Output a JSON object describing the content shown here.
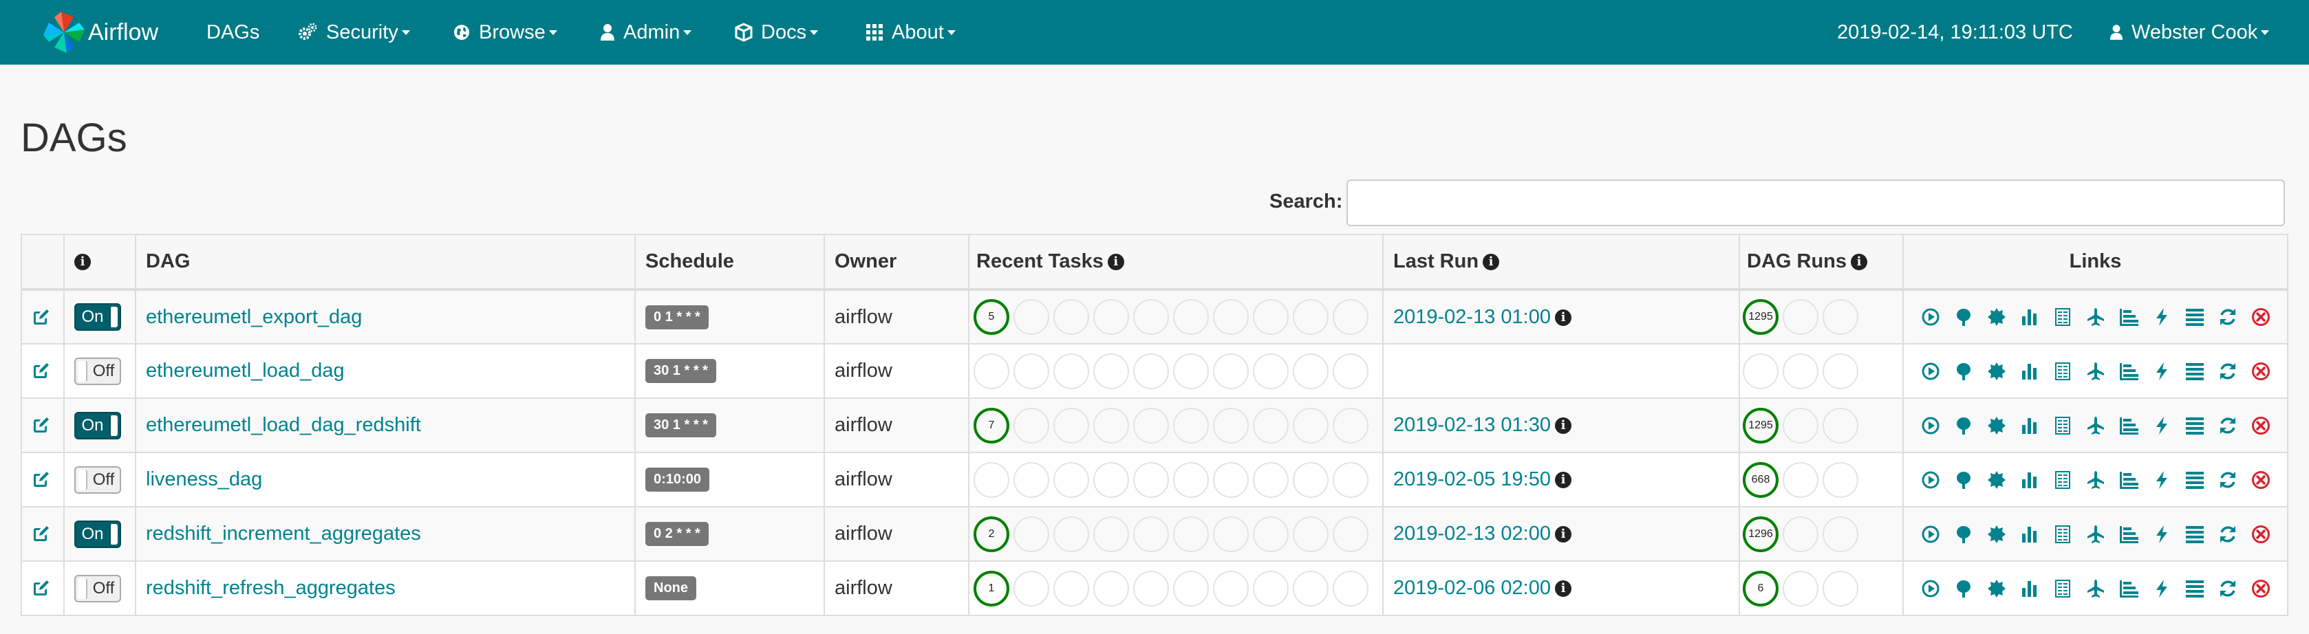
{
  "navbar": {
    "brand": "Airflow",
    "items": [
      {
        "label": "DAGs",
        "icon": "none",
        "dropdown": false
      },
      {
        "label": "Security",
        "icon": "cogs-icon",
        "dropdown": true
      },
      {
        "label": "Browse",
        "icon": "globe-icon",
        "dropdown": true
      },
      {
        "label": "Admin",
        "icon": "user-icon",
        "dropdown": true
      },
      {
        "label": "Docs",
        "icon": "cube-icon",
        "dropdown": true
      },
      {
        "label": "About",
        "icon": "th-icon",
        "dropdown": true
      }
    ],
    "clock": "2019-02-14, 19:11:03 UTC",
    "user": "Webster Cook"
  },
  "page": {
    "title": "DAGs",
    "search_label": "Search:",
    "search_value": ""
  },
  "table": {
    "headers": {
      "info": "i",
      "dag": "DAG",
      "schedule": "Schedule",
      "owner": "Owner",
      "recent_tasks": "Recent Tasks",
      "last_run": "Last Run",
      "dag_runs": "DAG Runs",
      "links": "Links"
    },
    "rows": [
      {
        "toggle": "On",
        "dag": "ethereumetl_export_dag",
        "schedule": "0 1 * * *",
        "owner": "airflow",
        "recent_tasks": [
          "5",
          "",
          "",
          "",
          "",
          "",
          "",
          "",
          "",
          ""
        ],
        "last_run": "2019-02-13 01:00",
        "dag_runs": [
          "1295",
          "",
          ""
        ]
      },
      {
        "toggle": "Off",
        "dag": "ethereumetl_load_dag",
        "schedule": "30 1 * * *",
        "owner": "airflow",
        "recent_tasks": [
          "",
          "",
          "",
          "",
          "",
          "",
          "",
          "",
          "",
          ""
        ],
        "last_run": "",
        "dag_runs": [
          "",
          "",
          ""
        ]
      },
      {
        "toggle": "On",
        "dag": "ethereumetl_load_dag_redshift",
        "schedule": "30 1 * * *",
        "owner": "airflow",
        "recent_tasks": [
          "7",
          "",
          "",
          "",
          "",
          "",
          "",
          "",
          "",
          ""
        ],
        "last_run": "2019-02-13 01:30",
        "dag_runs": [
          "1295",
          "",
          ""
        ]
      },
      {
        "toggle": "Off",
        "dag": "liveness_dag",
        "schedule": "0:10:00",
        "owner": "airflow",
        "recent_tasks": [
          "",
          "",
          "",
          "",
          "",
          "",
          "",
          "",
          "",
          ""
        ],
        "last_run": "2019-02-05 19:50",
        "dag_runs": [
          "668",
          "",
          ""
        ]
      },
      {
        "toggle": "On",
        "dag": "redshift_increment_aggregates",
        "schedule": "0 2 * * *",
        "owner": "airflow",
        "recent_tasks": [
          "2",
          "",
          "",
          "",
          "",
          "",
          "",
          "",
          "",
          ""
        ],
        "last_run": "2019-02-13 02:00",
        "dag_runs": [
          "1296",
          "",
          ""
        ]
      },
      {
        "toggle": "Off",
        "dag": "redshift_refresh_aggregates",
        "schedule": "None",
        "owner": "airflow",
        "recent_tasks": [
          "1",
          "",
          "",
          "",
          "",
          "",
          "",
          "",
          "",
          ""
        ],
        "last_run": "2019-02-06 02:00",
        "dag_runs": [
          "6",
          "",
          ""
        ]
      }
    ],
    "link_icons": [
      "trigger-dag-icon",
      "tree-view-icon",
      "graph-view-icon",
      "task-duration-icon",
      "task-tries-icon",
      "landing-times-icon",
      "gantt-icon",
      "code-view-icon",
      "logs-icon",
      "refresh-icon",
      "delete-dag-icon"
    ]
  },
  "colors": {
    "navbar": "#007a87",
    "link": "#00838f",
    "success": "#008000",
    "delete": "#d9232d"
  }
}
